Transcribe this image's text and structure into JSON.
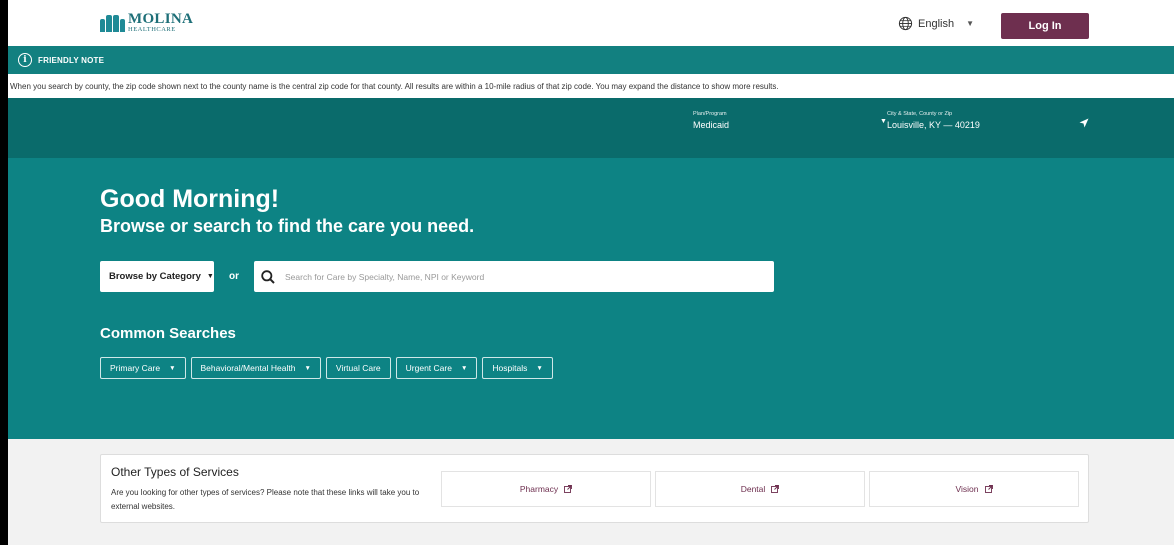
{
  "header": {
    "logo_name": "MOLINA",
    "logo_sub": "HEALTHCARE",
    "language": "English",
    "login_label": "Log In"
  },
  "note": {
    "title": "FRIENDLY NOTE",
    "text": "When you search by county, the zip code shown next to the county name is the central zip code for that county. All results are within a 10-mile radius of that zip code. You may expand the distance to show more results."
  },
  "plan": {
    "label": "Plan/Program",
    "value": "Medicaid"
  },
  "location": {
    "label": "City & State, County or Zip",
    "value": "Louisville, KY — 40219"
  },
  "hero": {
    "greeting": "Good Morning!",
    "subhead": "Browse or search to find the care you need.",
    "browse_label": "Browse by Category",
    "or_label": "or",
    "search_placeholder": "Search for Care by Specialty, Name, NPI or Keyword",
    "search_value": ""
  },
  "common": {
    "title": "Common Searches",
    "items": [
      {
        "label": "Primary Care",
        "has_dropdown": true
      },
      {
        "label": "Behavioral/Mental Health",
        "has_dropdown": true
      },
      {
        "label": "Virtual Care",
        "has_dropdown": false
      },
      {
        "label": "Urgent Care",
        "has_dropdown": true
      },
      {
        "label": "Hospitals",
        "has_dropdown": true
      }
    ]
  },
  "services": {
    "title": "Other Types of Services",
    "description": "Are you looking for other types of services? Please note that these links will take you to external websites.",
    "links": [
      "Pharmacy",
      "Dental",
      "Vision"
    ]
  },
  "colors": {
    "teal_dark": "#0a6b6b",
    "teal": "#0d8384",
    "note_teal": "#128080",
    "login_plum": "#6e2f4f"
  }
}
